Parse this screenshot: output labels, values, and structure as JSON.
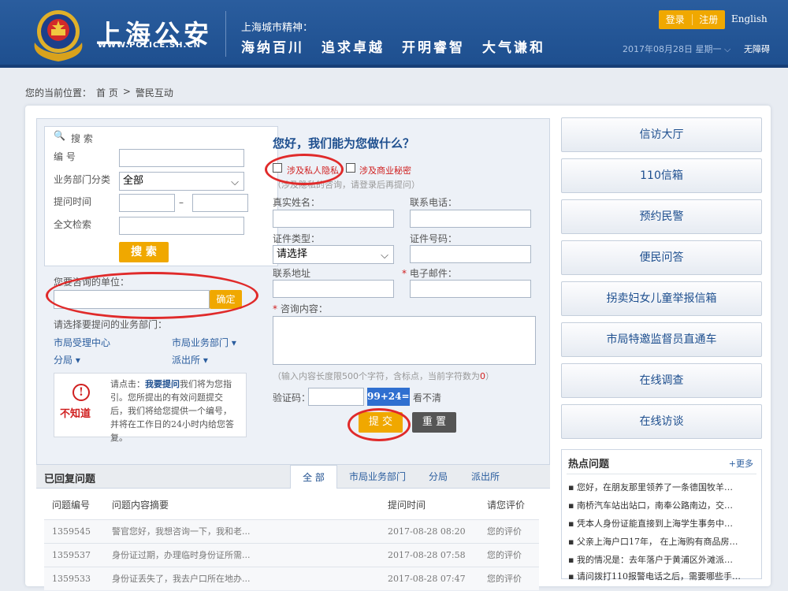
{
  "header": {
    "site_title": "上海公安",
    "site_url": "WWW.POLICE.SH.CN",
    "spirit_title": "上海城市精神：",
    "spirit_words": [
      "海纳百川",
      "追求卓越",
      "开明睿智",
      "大气谦和"
    ],
    "login": "登录",
    "register": "注册",
    "english": "English",
    "date": "2017年08月28日 星期一",
    "accessibility": "无障碍"
  },
  "breadcrumb": {
    "prefix": "您的当前位置：",
    "home": "首 页",
    "sep": ">",
    "current": "警民互动"
  },
  "search": {
    "title": "搜 索",
    "id_label": "编 号",
    "dept_label": "业务部门分类",
    "dept_value": "全部",
    "time_label": "提问时间",
    "dash": "–",
    "fulltext_label": "全文检索",
    "button": "搜 索"
  },
  "unit": {
    "label": "您要咨询的单位：",
    "confirm": "确定",
    "choose_label": "请选择要提问的业务部门：",
    "links": [
      "市局受理中心",
      "市局业务部门 ▾",
      "分局 ▾",
      "派出所 ▾"
    ]
  },
  "notice": {
    "icon_text": "不知道",
    "text_prefix": "请点击：",
    "text_link": "我要提问",
    "text_suffix": "我们将为您指引。您所提出的有效问题提交后，我们将给您提供一个编号，并将在工作日的24小时内给您答复。"
  },
  "form": {
    "title": "您好，我们能为您做什么？",
    "privacy": "涉及私人隐私",
    "business": "涉及商业秘密",
    "login_hint": "（涉及隐私的咨询，请登录后再提问）",
    "name_label": "真实姓名：",
    "phone_label": "联系电话：",
    "idtype_label": "证件类型：",
    "idtype_value": "请选择",
    "idno_label": "证件号码：",
    "address_label": "联系地址",
    "email_label": "电子邮件：",
    "content_label": "咨询内容：",
    "limit_hint": "（输入内容长度限500个字符，含标点，当前字符数为",
    "limit_count": "0",
    "limit_end": "）",
    "captcha_label": "验证码：",
    "captcha": "99+24=?",
    "captcha_refresh": "看不清",
    "submit": "提 交",
    "reset": "重 置"
  },
  "sidebar": {
    "items": [
      "信访大厅",
      "110信箱",
      "预约民警",
      "便民问答",
      "拐卖妇女儿童举报信箱",
      "市局特邀监督员直通车",
      "在线调查",
      "在线访谈"
    ]
  },
  "hot": {
    "title": "热点问题",
    "more": "+更多",
    "items": [
      "您好，在朋友那里领养了一条德国牧羊…",
      "南桥汽车站出站口，南奉公路南边，交…",
      "凭本人身份证能直接到上海学生事务中…",
      "父亲上海户口17年，  在上海购有商品房…",
      "我的情况是：去年落户于黄浦区外滩派…",
      "请问拨打110报警电话之后，需要哪些手…"
    ]
  },
  "answered": {
    "title": "已回复问题",
    "tabs": [
      "全 部",
      "市局业务部门",
      "分局",
      "派出所"
    ],
    "columns": [
      "问题编号",
      "问题内容摘要",
      "提问时间",
      "请您评价"
    ],
    "rows": [
      [
        "1359545",
        "警官您好，我想咨询一下，我和老...",
        "2017-08-28 08:20",
        "您的评价"
      ],
      [
        "1359537",
        "身份证过期，办理临时身份证所需...",
        "2017-08-28 07:58",
        "您的评价"
      ],
      [
        "1359533",
        "身份证丢失了，我去户口所在地办...",
        "2017-08-28 07:47",
        "您的评价"
      ]
    ]
  }
}
